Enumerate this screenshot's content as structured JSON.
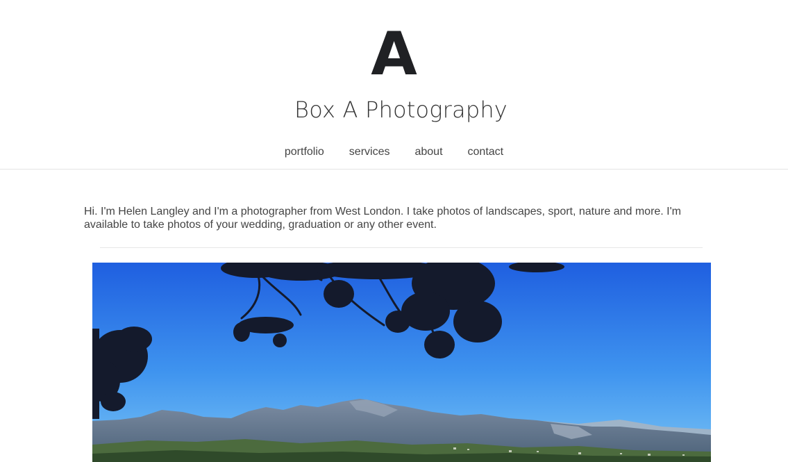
{
  "header": {
    "logo_letter": "A",
    "site_title": "Box A Photography"
  },
  "nav": {
    "items": [
      {
        "label": "portfolio"
      },
      {
        "label": "services"
      },
      {
        "label": "about"
      },
      {
        "label": "contact"
      }
    ]
  },
  "intro": {
    "text": "Hi. I'm Helen Langley and I'm a photographer from West London. I take photos of landscapes, sport, nature and more. I'm available to take photos of your wedding, graduation or any other event."
  },
  "colors": {
    "sky_top": "#1f5fe0",
    "sky_bottom": "#5cb3f2",
    "mountain": "#6f8098",
    "foliage": "#141a2c"
  }
}
